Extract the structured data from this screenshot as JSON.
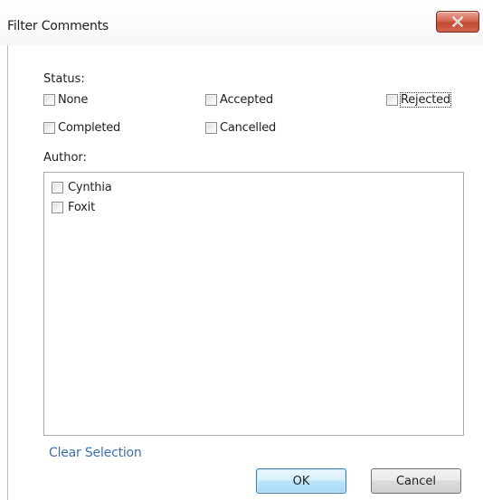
{
  "window": {
    "title": "Filter Comments"
  },
  "status": {
    "label": "Status:",
    "options": [
      {
        "label": "None",
        "checked": false
      },
      {
        "label": "Accepted",
        "checked": false
      },
      {
        "label": "Rejected",
        "checked": false,
        "focused": true
      },
      {
        "label": "Completed",
        "checked": false
      },
      {
        "label": "Cancelled",
        "checked": false
      }
    ]
  },
  "author": {
    "label": "Author:",
    "items": [
      {
        "label": "Cynthia",
        "checked": false
      },
      {
        "label": "Foxit",
        "checked": false
      }
    ]
  },
  "clear_selection_label": "Clear Selection",
  "buttons": {
    "ok_label": "OK",
    "cancel_label": "Cancel"
  },
  "colors": {
    "link": "#3d6fa9",
    "close_button": "#c24a34",
    "default_button_border": "#3c7fb1"
  },
  "icons": {
    "close": "close-icon"
  }
}
